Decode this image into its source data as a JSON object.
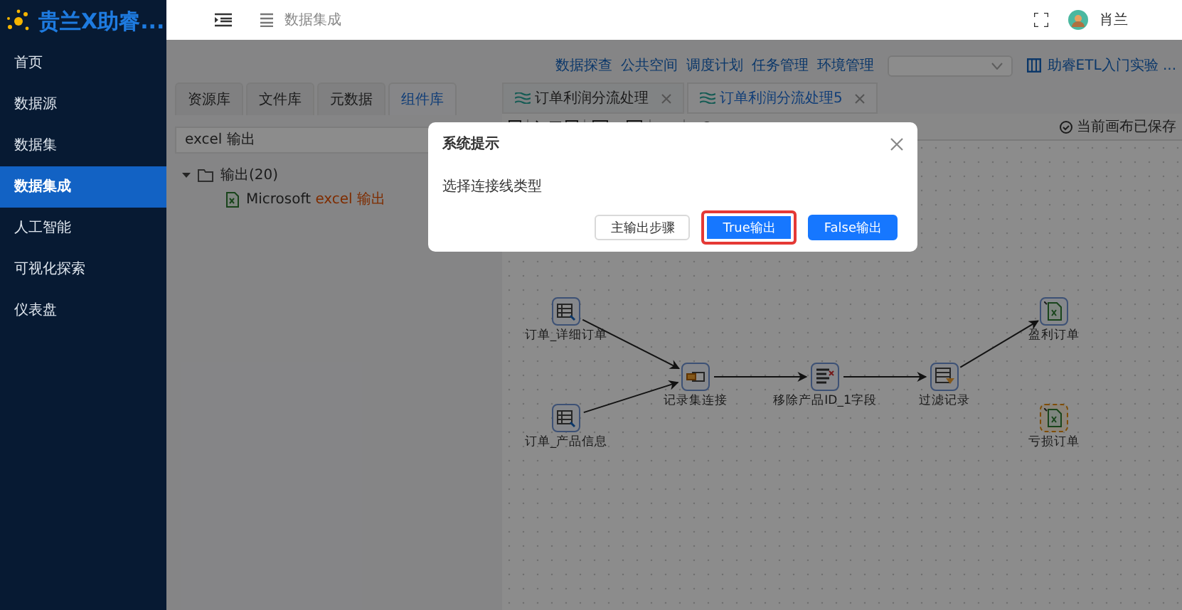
{
  "sidebar": {
    "brand": "贵兰X助睿...",
    "items": [
      {
        "label": "首页",
        "selected": false
      },
      {
        "label": "数据源",
        "selected": false
      },
      {
        "label": "数据集",
        "selected": false
      },
      {
        "label": "数据集成",
        "selected": true
      },
      {
        "label": "人工智能",
        "selected": false
      },
      {
        "label": "可视化探索",
        "selected": false
      },
      {
        "label": "仪表盘",
        "selected": false
      }
    ]
  },
  "header": {
    "breadcrumb": "数据集成",
    "user": "肖兰"
  },
  "top_links": [
    "数据探查",
    "公共空间",
    "调度计划",
    "任务管理",
    "环境管理"
  ],
  "project_link": "助睿ETL入门实验 ...",
  "left_panel": {
    "tabs": [
      {
        "label": "资源库",
        "selected": false
      },
      {
        "label": "文件库",
        "selected": false
      },
      {
        "label": "元数据",
        "selected": false
      },
      {
        "label": "组件库",
        "selected": true
      }
    ],
    "search": {
      "value": "excel 输出"
    },
    "tree": [
      {
        "label": "输出(20)",
        "expanded": true,
        "children": [
          {
            "prefix": "Microsoft ",
            "match": "excel 输出"
          }
        ]
      }
    ]
  },
  "editor_tabs": [
    {
      "label": "订单利润分流处理",
      "selected": false
    },
    {
      "label": "订单利润分流处理5",
      "selected": true
    }
  ],
  "save_status": "当前画布已保存",
  "canvas": {
    "nodes": [
      {
        "label": "订单_详细订单",
        "kind": "table-input",
        "selected": false
      },
      {
        "label": "订单_产品信息",
        "kind": "table-input",
        "selected": false
      },
      {
        "label": "记录集连接",
        "kind": "join",
        "selected": false
      },
      {
        "label": "移除产品ID_1字段",
        "kind": "remove-field",
        "selected": false
      },
      {
        "label": "过滤记录",
        "kind": "filter",
        "selected": false
      },
      {
        "label": "盈利订单",
        "kind": "excel-output",
        "selected": false
      },
      {
        "label": "亏损订单",
        "kind": "excel-output",
        "selected": true
      }
    ]
  },
  "dialog": {
    "title": "系统提示",
    "message": "选择连接线类型",
    "buttons": [
      {
        "label": "主输出步骤",
        "kind": "default",
        "highlighted": false
      },
      {
        "label": "True输出",
        "kind": "primary",
        "highlighted": true
      },
      {
        "label": "False输出",
        "kind": "primary",
        "highlighted": false
      }
    ]
  }
}
